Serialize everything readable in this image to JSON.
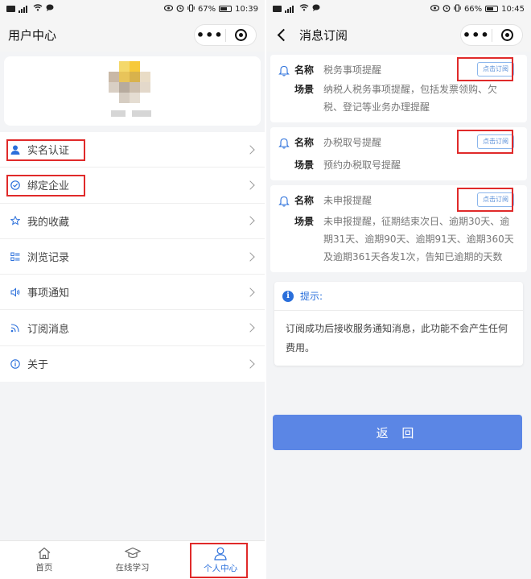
{
  "left": {
    "status": {
      "time": "10:39",
      "battery": "67%",
      "battery_level": 0.67
    },
    "nav": {
      "title": "用户中心"
    },
    "menu": [
      {
        "label": "实名认证",
        "icon": "person-icon"
      },
      {
        "label": "绑定企业",
        "icon": "check-circle-icon"
      },
      {
        "label": "我的收藏",
        "icon": "star-icon"
      },
      {
        "label": "浏览记录",
        "icon": "list-icon"
      },
      {
        "label": "事项通知",
        "icon": "speaker-icon"
      },
      {
        "label": "订阅消息",
        "icon": "rss-icon"
      },
      {
        "label": "关于",
        "icon": "info-icon"
      }
    ],
    "tabs": [
      {
        "label": "首页",
        "icon": "home-icon"
      },
      {
        "label": "在线学习",
        "icon": "graduation-cap-icon"
      },
      {
        "label": "个人中心",
        "icon": "user-icon"
      }
    ]
  },
  "right": {
    "status": {
      "time": "10:45",
      "battery": "66%",
      "battery_level": 0.66
    },
    "nav": {
      "title": "消息订阅"
    },
    "name_key": "名称",
    "scene_key": "场景",
    "subscribe_label": "点击订阅",
    "items": [
      {
        "name": "税务事项提醒",
        "scene_lines": [
          "纳税人税务事项提醒，包括发票领购、欠",
          "税、登记等业务办理提醒"
        ]
      },
      {
        "name": "办税取号提醒",
        "scene_lines": [
          "预约办税取号提醒"
        ]
      },
      {
        "name": "未申报提醒",
        "scene_lines": [
          "未申报提醒，征期结束次日、逾期30天、逾",
          "期31天、逾期90天、逾期91天、逾期360天",
          "及逾期361天各发1次，告知已逾期的天数"
        ]
      }
    ],
    "tip": {
      "title": "提示:",
      "body_lines": [
        "订阅成功后接收服务通知消息，此功能不会产生任何",
        "费用。"
      ]
    },
    "return_label": "返 回"
  },
  "colors": {
    "accent": "#2a6fdb",
    "button": "#5b86e5",
    "highlight": "#e02a2a"
  }
}
